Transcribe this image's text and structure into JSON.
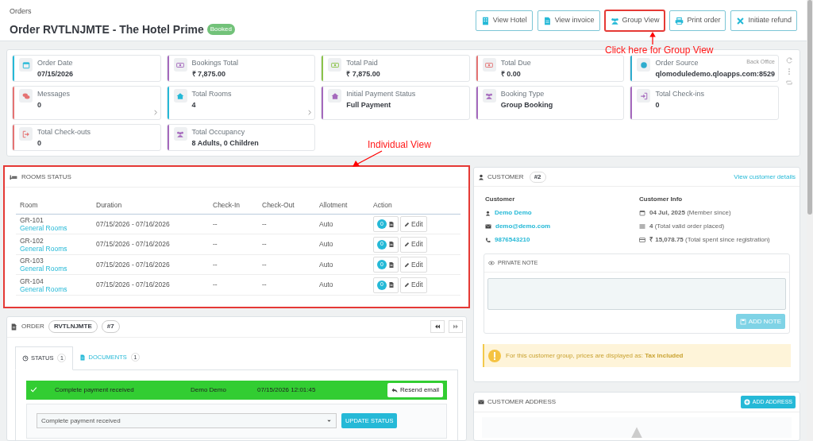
{
  "breadcrumb": "Orders",
  "title": "Order RVTLNJMTE - The Hotel Prime",
  "status_badge": "Booked",
  "header_buttons": [
    {
      "label": "View Hotel",
      "kind": "building",
      "highlighted": false
    },
    {
      "label": "View invoice",
      "kind": "file",
      "highlighted": false
    },
    {
      "label": "Group View",
      "kind": "users",
      "highlighted": true
    },
    {
      "label": "Print order",
      "kind": "print",
      "highlighted": false
    },
    {
      "label": "Initiate refund",
      "kind": "cross",
      "highlighted": false
    }
  ],
  "annotations": [
    {
      "text": "Click here for Group View",
      "kind": "group"
    },
    {
      "text": "Individual View",
      "kind": "individual"
    }
  ],
  "kpis": [
    {
      "label": "Order Date",
      "value": "07/15/2026",
      "kind": "calendar",
      "color": "#25b9d7",
      "has_link": false
    },
    {
      "label": "Bookings Total",
      "value": "₹ 7,875.00",
      "kind": "money",
      "color": "#a569bd",
      "has_link": false
    },
    {
      "label": "Total Paid",
      "value": "₹ 7,875.00",
      "kind": "money",
      "color": "#8bc34a",
      "has_link": false
    },
    {
      "label": "Total Due",
      "value": "₹ 0.00",
      "kind": "money",
      "color": "#e57373",
      "has_link": false
    },
    {
      "label": "Order Source",
      "value": "qlomoduledemo.qloapps.com:8529",
      "kind": "globe",
      "color": "#2eacce",
      "has_link": false,
      "note": "Back Office"
    },
    {
      "label": "Messages",
      "value": "0",
      "kind": "chat",
      "color": "#e57373",
      "has_link": true
    },
    {
      "label": "Total Rooms",
      "value": "4",
      "kind": "home",
      "color": "#25b9d7",
      "has_link": true
    },
    {
      "label": "Initial Payment Status",
      "value": "Full Payment",
      "kind": "home",
      "color": "#a569bd",
      "has_link": false
    },
    {
      "label": "Booking Type",
      "value": "Group Booking",
      "kind": "users",
      "color": "#a569bd",
      "has_link": false
    },
    {
      "label": "Total Check-ins",
      "value": "0",
      "kind": "signin",
      "color": "#a569bd",
      "has_link": false
    },
    {
      "label": "Total Check-outs",
      "value": "0",
      "kind": "signout",
      "color": "#e57373",
      "has_link": false
    },
    {
      "label": "Total Occupancy",
      "value": "8 Adults, 0 Children",
      "kind": "users",
      "color": "#a569bd",
      "has_link": false
    }
  ],
  "rooms_status": {
    "title": "ROOMS STATUS",
    "highlighted": true,
    "columns": [
      "Room",
      "Duration",
      "Check-In",
      "Check-Out",
      "Allotment",
      "Action"
    ],
    "rows": [
      {
        "room": "GR-101",
        "room_type": "General Rooms",
        "duration": "07/15/2026 - 07/16/2026",
        "check_in": "--",
        "check_out": "--",
        "allotment": "Auto",
        "documents": "0",
        "edit": "Edit"
      },
      {
        "room": "GR-102",
        "room_type": "General Rooms",
        "duration": "07/15/2026 - 07/16/2026",
        "check_in": "--",
        "check_out": "--",
        "allotment": "Auto",
        "documents": "0",
        "edit": "Edit"
      },
      {
        "room": "GR-103",
        "room_type": "General Rooms",
        "duration": "07/15/2026 - 07/16/2026",
        "check_in": "--",
        "check_out": "--",
        "allotment": "Auto",
        "documents": "0",
        "edit": "Edit"
      },
      {
        "room": "GR-104",
        "room_type": "General Rooms",
        "duration": "07/15/2026 - 07/16/2026",
        "check_in": "--",
        "check_out": "--",
        "allotment": "Auto",
        "documents": "0",
        "edit": "Edit"
      }
    ]
  },
  "order": {
    "title": "ORDER",
    "reference": "RVTLNJMTE",
    "id": "#7",
    "tabs": [
      {
        "label": "STATUS",
        "count": "1",
        "kind": "clock",
        "selected": true
      },
      {
        "label": "DOCUMENTS",
        "count": "1",
        "kind": "file",
        "selected": false
      }
    ],
    "history": [
      {
        "status": "Complete payment received",
        "employee": "Demo Demo",
        "date": "07/15/2026 12:01:45",
        "button": "Resend email"
      }
    ],
    "status_select": {
      "value": "Complete payment received"
    },
    "update_button": "UPDATE STATUS"
  },
  "customer": {
    "title": "CUSTOMER",
    "id": "#2",
    "details_link": "View customer details",
    "customer_heading": "Customer",
    "name": "Demo Demo",
    "email": "demo@demo.com",
    "phone": "9876543210",
    "info_heading": "Customer Info",
    "info": [
      {
        "kind": "calendar",
        "text": "**04 Jul, 2025** (Member since)"
      },
      {
        "kind": "list",
        "text": "**4** (Total valid order placed)"
      },
      {
        "kind": "card",
        "text": "**₹ 15,078.75** (Total spent since registration)"
      }
    ],
    "private_note": {
      "title": "PRIVATE NOTE",
      "button": "ADD NOTE"
    },
    "warning": "For this customer group, prices are displayed as: **Tax included**"
  },
  "customer_address": {
    "title": "CUSTOMER ADDRESS",
    "button": "ADD ADDRESS"
  }
}
